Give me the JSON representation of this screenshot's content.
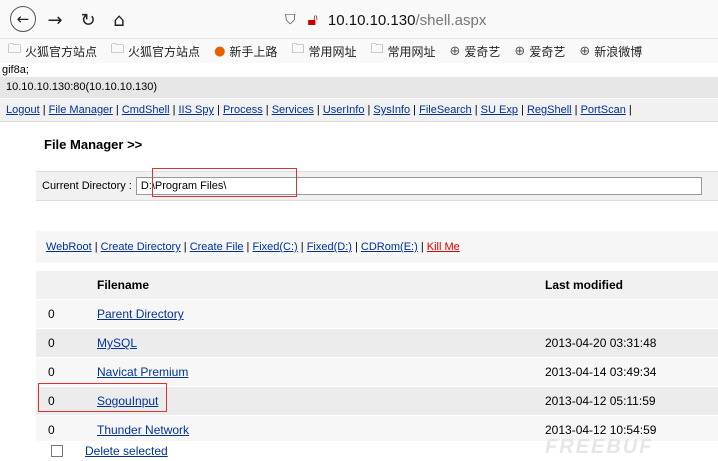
{
  "browser": {
    "url_host": "10.10.10.130",
    "url_path": "/shell.aspx",
    "bookmarks": [
      {
        "label": "火狐官方站点",
        "icon": "folder-icon"
      },
      {
        "label": "火狐官方站点",
        "icon": "folder-icon"
      },
      {
        "label": "新手上路",
        "icon": "firefox-icon"
      },
      {
        "label": "常用网址",
        "icon": "folder-icon"
      },
      {
        "label": "常用网址",
        "icon": "folder-icon"
      },
      {
        "label": "爱奇艺",
        "icon": "globe-icon"
      },
      {
        "label": "爱奇艺",
        "icon": "globe-icon"
      },
      {
        "label": "新浪微博",
        "icon": "globe-icon"
      }
    ]
  },
  "page": {
    "top_text": "gif8a;",
    "host_info": "10.10.10.130:80(10.10.10.130)",
    "nav_links": [
      "Logout",
      "File Manager",
      "CmdShell",
      "IIS Spy",
      "Process",
      "Services",
      "UserInfo",
      "SysInfo",
      "FileSearch",
      "SU Exp",
      "RegShell",
      "PortScan"
    ],
    "section_title": "File Manager >>",
    "current_dir_label": "Current Directory :",
    "current_dir_value": "D:\\Program Files\\",
    "op_links": [
      "WebRoot",
      "Create Directory",
      "Create File",
      "Fixed(C:)",
      "Fixed(D:)",
      "CDRom(E:)"
    ],
    "kill_label": "Kill Me",
    "table": {
      "headers": [
        "",
        "Filename",
        "Last modified"
      ],
      "rows": [
        {
          "num": "0",
          "name": "Parent Directory",
          "modified": ""
        },
        {
          "num": "0",
          "name": "MySQL",
          "modified": "2013-04-20 03:31:48"
        },
        {
          "num": "0",
          "name": "Navicat Premium",
          "modified": "2013-04-14 03:49:34"
        },
        {
          "num": "0",
          "name": "SogouInput",
          "modified": "2013-04-12 05:11:59"
        },
        {
          "num": "0",
          "name": "Thunder Network",
          "modified": "2013-04-12 10:54:59"
        }
      ]
    },
    "delete_label": "Delete selected",
    "watermark": "FREEBUF"
  },
  "colors": {
    "link": "#003399",
    "highlight_box": "#e03030"
  }
}
